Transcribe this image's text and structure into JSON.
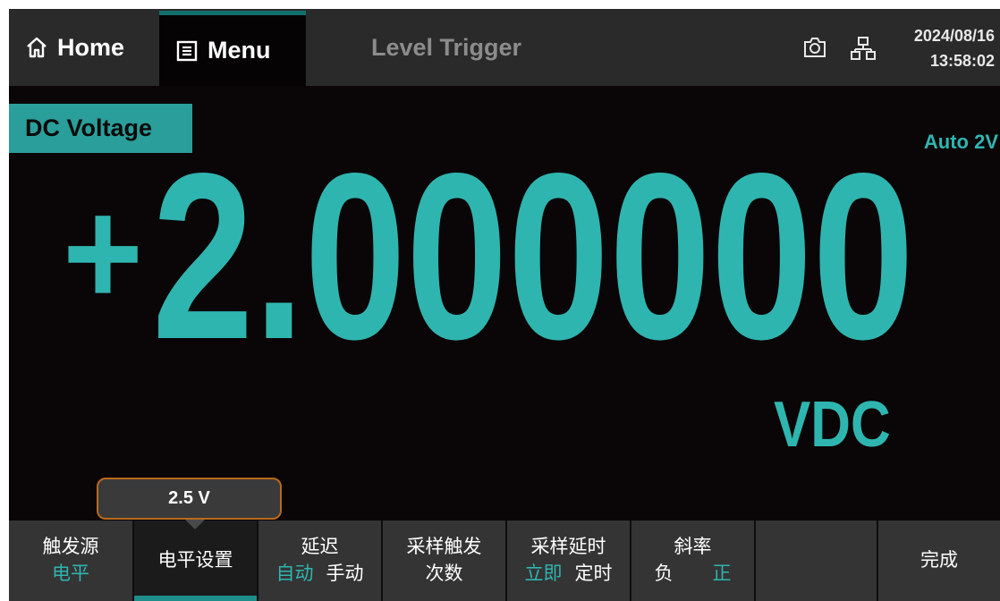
{
  "topbar": {
    "home_label": "Home",
    "menu_label": "Menu",
    "mode_title": "Level Trigger",
    "date": "2024/08/16",
    "time": "13:58:02"
  },
  "measurement": {
    "function": "DC Voltage",
    "range": "Auto 2V",
    "sign": "+",
    "value": "2.000000",
    "unit": "VDC"
  },
  "popup": {
    "value": "2.5 V"
  },
  "softkeys": [
    {
      "line1": "触发源",
      "line2": "电平"
    },
    {
      "label": "电平设置",
      "active": true
    },
    {
      "label": "延迟",
      "options": [
        "自动",
        "手动"
      ],
      "selected": 0
    },
    {
      "line1": "采样触发",
      "line2": "次数"
    },
    {
      "label": "采样延时",
      "options": [
        "立即",
        "定时"
      ],
      "selected": 0
    },
    {
      "label": "斜率",
      "options": [
        "负",
        "正"
      ],
      "selected": 1
    },
    {
      "label": ""
    },
    {
      "label": "完成"
    }
  ],
  "colors": {
    "accent": "#2fb5b0",
    "badge": "#2a9e9a",
    "background": "#0a0506",
    "popup_border": "#b86a1c"
  },
  "icons": [
    "home-icon",
    "menu-list-icon",
    "camera-icon",
    "network-icon"
  ]
}
